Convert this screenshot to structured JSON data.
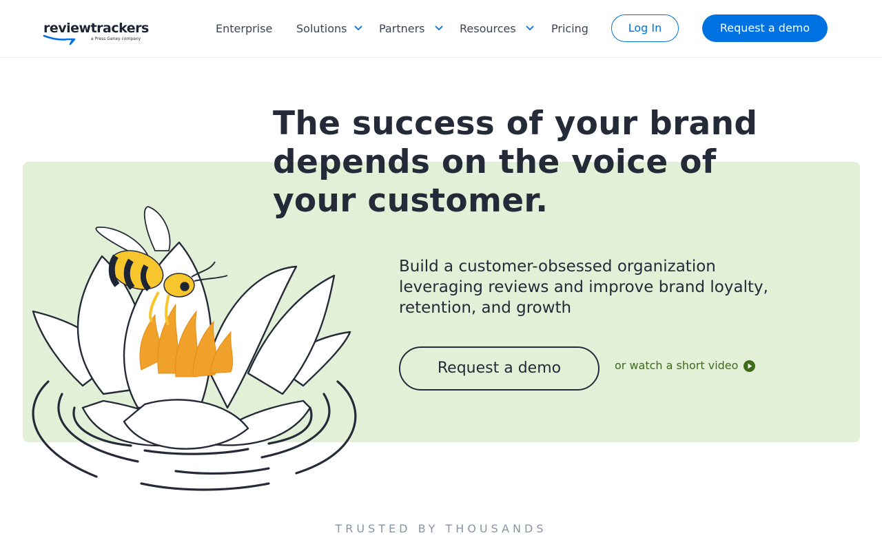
{
  "header": {
    "logo": {
      "wordmark": "reviewtrackers",
      "tagline": "a Press Ganey company"
    },
    "nav": [
      {
        "label": "Enterprise",
        "has_dropdown": false
      },
      {
        "label": "Solutions",
        "has_dropdown": true
      },
      {
        "label": "Partners",
        "has_dropdown": true
      },
      {
        "label": "Resources",
        "has_dropdown": true
      },
      {
        "label": "Pricing",
        "has_dropdown": false
      }
    ],
    "login_label": "Log In",
    "demo_label": "Request a demo"
  },
  "hero": {
    "title": "The success of your brand depends on the voice of your customer.",
    "subtitle": "Build a customer-obsessed organization leveraging reviews and improve brand loyalty, retention, and growth",
    "demo_label": "Request a demo",
    "video_link": "or watch a short video",
    "illustration_icon": "bee-on-lotus-illustration"
  },
  "trusted": {
    "label": "TRUSTED BY THOUSANDS"
  },
  "colors": {
    "accent": "#0071e0",
    "hero_panel": "#e3f0d8",
    "heading": "#252a38",
    "video_link": "#3d6b18",
    "bee_yellow": "#f7c52c",
    "flame_orange": "#f0a12a"
  }
}
